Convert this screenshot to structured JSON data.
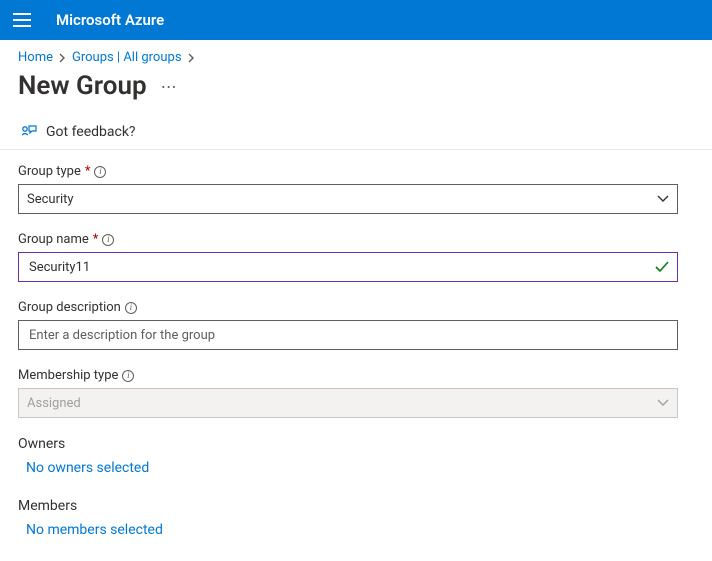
{
  "header": {
    "brand": "Microsoft Azure"
  },
  "breadcrumb": {
    "home": "Home",
    "groups": "Groups | All groups"
  },
  "page": {
    "title": "New Group",
    "feedback_label": "Got feedback?"
  },
  "form": {
    "group_type": {
      "label": "Group type",
      "value": "Security"
    },
    "group_name": {
      "label": "Group name",
      "value": "Security11"
    },
    "group_description": {
      "label": "Group description",
      "placeholder": "Enter a description for the group",
      "value": ""
    },
    "membership_type": {
      "label": "Membership type",
      "value": "Assigned"
    },
    "owners": {
      "label": "Owners",
      "none_text": "No owners selected"
    },
    "members": {
      "label": "Members",
      "none_text": "No members selected"
    }
  }
}
